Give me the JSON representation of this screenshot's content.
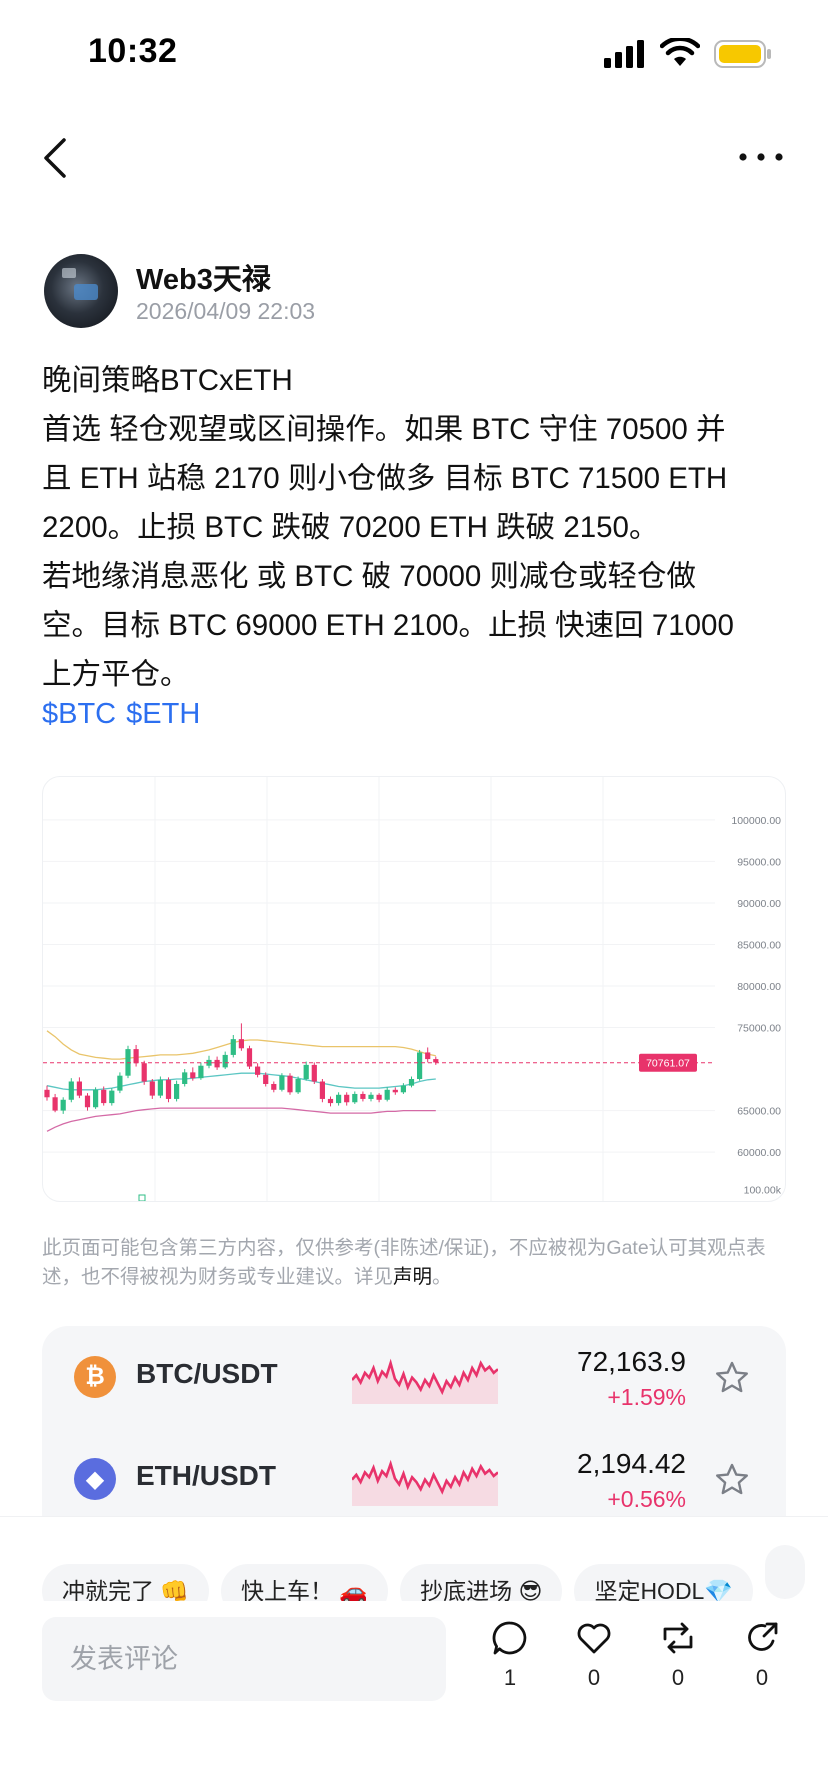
{
  "status_bar": {
    "time": "10:32",
    "icons": [
      "signal-icon",
      "wifi-icon",
      "battery-icon"
    ],
    "battery_color": "#f7c800"
  },
  "nav": {
    "back_icon": "chevron-left-icon",
    "more_icon": "ellipsis-icon"
  },
  "post": {
    "author": "Web3天禄",
    "timestamp": "2026/04/09 22:03",
    "lines": [
      "晚间策略BTCxETH",
      "首选 轻仓观望或区间操作。如果 BTC 守住 70500 并",
      "且 ETH 站稳 2170 则小仓做多 目标 BTC 71500 ETH",
      "2200。止损 BTC 跌破 70200 ETH 跌破 2150。",
      "若地缘消息恶化 或 BTC 破 70000 则减仓或轻仓做",
      "空。目标 BTC 69000 ETH 2100。止损 快速回 71000",
      "上方平仓。"
    ],
    "tags": [
      "$BTC",
      "$ETH"
    ]
  },
  "chart_data": {
    "type": "candlestick",
    "y_ticks": [
      "100000.00",
      "95000.00",
      "90000.00",
      "85000.00",
      "80000.00",
      "75000.00",
      "65000.00",
      "60000.00"
    ],
    "volume_tick": "100.00k",
    "current_price_label": "70761.07",
    "current_price": 70761.07,
    "ylim": [
      57000,
      103000
    ],
    "candles": [
      [
        67500,
        66600,
        68000,
        66200
      ],
      [
        66600,
        65000,
        67000,
        64800
      ],
      [
        65000,
        66300,
        66600,
        64600
      ],
      [
        66300,
        68500,
        68900,
        66000
      ],
      [
        68500,
        66800,
        69000,
        66500
      ],
      [
        66800,
        65400,
        67100,
        65000
      ],
      [
        65400,
        67500,
        67800,
        65200
      ],
      [
        67500,
        65900,
        67900,
        65600
      ],
      [
        65900,
        67400,
        67700,
        65600
      ],
      [
        67400,
        69200,
        69600,
        67100
      ],
      [
        69200,
        72400,
        72800,
        68900
      ],
      [
        72400,
        70700,
        72900,
        70300
      ],
      [
        70700,
        68500,
        71000,
        68100
      ],
      [
        68500,
        66800,
        68800,
        66400
      ],
      [
        66800,
        68700,
        69100,
        66500
      ],
      [
        68700,
        66400,
        69000,
        66000
      ],
      [
        66400,
        68200,
        68600,
        66100
      ],
      [
        68200,
        69600,
        70000,
        67900
      ],
      [
        69600,
        68900,
        70200,
        68600
      ],
      [
        68900,
        70400,
        70800,
        68700
      ],
      [
        70400,
        71100,
        71600,
        70100
      ],
      [
        71100,
        70200,
        71500,
        69900
      ],
      [
        70200,
        71700,
        72100,
        70000
      ],
      [
        71700,
        73600,
        74100,
        71400
      ],
      [
        73600,
        72500,
        75500,
        72200
      ],
      [
        72500,
        70300,
        72800,
        70000
      ],
      [
        70300,
        69300,
        70700,
        69000
      ],
      [
        69300,
        68200,
        69600,
        67900
      ],
      [
        68200,
        67500,
        68500,
        67200
      ],
      [
        67500,
        69200,
        69500,
        67300
      ],
      [
        69200,
        67200,
        69500,
        66900
      ],
      [
        67200,
        68800,
        69100,
        67000
      ],
      [
        68800,
        70500,
        70900,
        68600
      ],
      [
        70500,
        68500,
        70800,
        68200
      ],
      [
        68500,
        66400,
        68800,
        66000
      ],
      [
        66400,
        65900,
        66700,
        65500
      ],
      [
        65900,
        66900,
        67200,
        65600
      ],
      [
        66900,
        66000,
        67200,
        65600
      ],
      [
        66000,
        67000,
        67300,
        65800
      ],
      [
        67000,
        66400,
        67300,
        66100
      ],
      [
        66400,
        66900,
        67200,
        66100
      ],
      [
        66900,
        66300,
        67100,
        66000
      ],
      [
        66300,
        67500,
        67800,
        66100
      ],
      [
        67500,
        67200,
        67800,
        66900
      ],
      [
        67200,
        68000,
        68300,
        67000
      ],
      [
        68000,
        68800,
        69100,
        67800
      ],
      [
        68800,
        72000,
        72300,
        68600
      ],
      [
        72000,
        71200,
        72600,
        70800
      ],
      [
        71200,
        70800,
        71500,
        70500
      ]
    ],
    "upper_band": [
      74600,
      73900,
      73000,
      72300,
      71800,
      71600,
      71400,
      71300,
      71200,
      71200,
      71300,
      71400,
      71500,
      71600,
      71700,
      71700,
      71700,
      71800,
      71900,
      72100,
      72300,
      72600,
      72900,
      73200,
      73400,
      73500,
      73500,
      73400,
      73300,
      73200,
      73100,
      73000,
      72900,
      72800,
      72700,
      72700,
      72700,
      72700,
      72700,
      72700,
      72700,
      72700,
      72700,
      72700,
      72600,
      72400,
      72100,
      71800,
      71600
    ],
    "middle_band": [
      68000,
      67800,
      67600,
      67500,
      67500,
      67500,
      67500,
      67600,
      67700,
      67900,
      68100,
      68300,
      68500,
      68600,
      68700,
      68700,
      68800,
      68800,
      68900,
      69000,
      69100,
      69200,
      69300,
      69400,
      69500,
      69500,
      69500,
      69400,
      69300,
      69200,
      69100,
      68900,
      68700,
      68500,
      68300,
      68100,
      67900,
      67800,
      67700,
      67700,
      67700,
      67700,
      67800,
      67900,
      68000,
      68200,
      68500,
      68700,
      68800
    ],
    "lower_band": [
      62500,
      63000,
      63400,
      63700,
      63900,
      64100,
      64300,
      64400,
      64500,
      64600,
      64800,
      65000,
      65100,
      65200,
      65300,
      65300,
      65300,
      65300,
      65300,
      65300,
      65300,
      65300,
      65300,
      65300,
      65300,
      65300,
      65300,
      65300,
      65300,
      65300,
      65200,
      65100,
      65000,
      64900,
      64800,
      64700,
      64700,
      64700,
      64700,
      64700,
      64700,
      64800,
      64900,
      64900,
      65000,
      65000,
      65000,
      65000,
      65000
    ],
    "colors": {
      "up": "#2ebd85",
      "down": "#e8336b",
      "upper": "#e9c46a",
      "middle": "#5cc6c3",
      "lower": "#d46aa6"
    }
  },
  "disclaimer": {
    "text": "此页面可能包含第三方内容，仅供参考(非陈述/保证)，不应被视为Gate认可其观点表述，也不得被视为财务或专业建议。详见",
    "link": "声明",
    "suffix": "。"
  },
  "markets": [
    {
      "pair": "BTC/USDT",
      "icon": "bitcoin-icon",
      "icon_color": "#f0913b",
      "icon_glyph": "₿",
      "price": "72,163.9",
      "change": "+1.59%",
      "spark": [
        20,
        24,
        18,
        26,
        22,
        30,
        19,
        27,
        23,
        34,
        21,
        16,
        25,
        14,
        22,
        18,
        12,
        20,
        15,
        24,
        17,
        10,
        19,
        14,
        22,
        16,
        26,
        20,
        30,
        24,
        34,
        28,
        31,
        26,
        29
      ]
    },
    {
      "pair": "ETH/USDT",
      "icon": "ethereum-icon",
      "icon_color": "#5a6ddf",
      "icon_glyph": "◆",
      "price": "2,194.42",
      "change": "+0.56%",
      "spark": [
        22,
        26,
        20,
        28,
        24,
        32,
        21,
        29,
        25,
        35,
        23,
        18,
        27,
        16,
        24,
        20,
        14,
        22,
        17,
        26,
        19,
        12,
        21,
        16,
        24,
        18,
        28,
        22,
        31,
        25,
        33,
        27,
        30,
        25,
        28
      ]
    }
  ],
  "quick_replies": [
    "冲就完了 👊",
    "快上车！ 🚗",
    "抄底进场 😎",
    "坚定HODL💎",
    ""
  ],
  "comment": {
    "placeholder": "发表评论"
  },
  "actions": [
    {
      "name": "comment",
      "icon": "comment-icon",
      "count": "1"
    },
    {
      "name": "like",
      "icon": "heart-icon",
      "count": "0"
    },
    {
      "name": "repost",
      "icon": "repost-icon",
      "count": "0"
    },
    {
      "name": "share",
      "icon": "share-icon",
      "count": "0"
    }
  ]
}
